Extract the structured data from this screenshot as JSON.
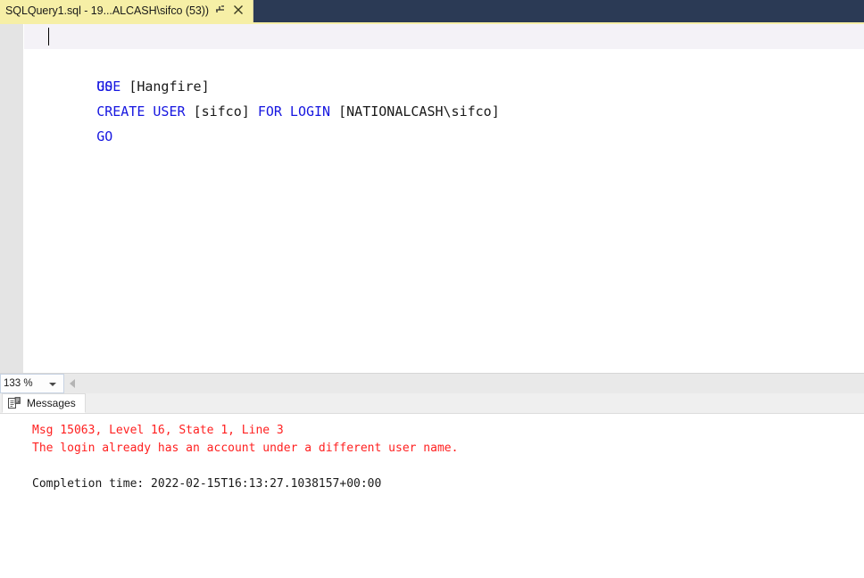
{
  "window": {
    "tabstrip_bg": "#2b3a55",
    "active_tab_bg": "#f6efa6"
  },
  "document_tab": {
    "title": "SQLQuery1.sql - 19...ALCASH\\sifco (53))",
    "pin_icon": "pin-icon",
    "close_icon": "close-icon"
  },
  "editor": {
    "keyword_color": "#1717e0",
    "text_color": "#1a1a1a",
    "lines": [
      {
        "segments": [
          {
            "text": "USE ",
            "type": "keyword"
          },
          {
            "text": "[Hangfire]",
            "type": "plain"
          }
        ]
      },
      {
        "segments": [
          {
            "text": "GO",
            "type": "keyword"
          }
        ]
      },
      {
        "segments": [
          {
            "text": "CREATE USER ",
            "type": "keyword"
          },
          {
            "text": "[sifco] ",
            "type": "plain"
          },
          {
            "text": "FOR LOGIN ",
            "type": "keyword"
          },
          {
            "text": "[NATIONALCASH\\sifco]",
            "type": "plain"
          }
        ]
      },
      {
        "segments": [
          {
            "text": "GO",
            "type": "keyword"
          }
        ]
      }
    ],
    "line1_text": "USE ",
    "line1_rest": "[Hangfire]",
    "line2_text": "GO",
    "line3_kw1": "CREATE USER ",
    "line3_arg1": "[sifco] ",
    "line3_kw2": "FOR LOGIN ",
    "line3_arg2": "[NATIONALCASH\\sifco]",
    "line4_text": "GO"
  },
  "status_row": {
    "zoom_level": "133 %",
    "zoom_dropdown_icon": "chevron-down-icon",
    "scroll_left_icon": "scroll-left-arrow-icon"
  },
  "results": {
    "tab_label": "Messages",
    "tab_icon": "messages-icon",
    "error_color": "#ff2020",
    "messages": [
      {
        "text": "Msg 15063, Level 16, State 1, Line 3",
        "style": "error"
      },
      {
        "text": "The login already has an account under a different user name.",
        "style": "error"
      },
      {
        "text": "",
        "style": "blank"
      },
      {
        "text": "Completion time: 2022-02-15T16:13:27.1038157+00:00",
        "style": "normal"
      }
    ],
    "msg_error_line1": "Msg 15063, Level 16, State 1, Line 3",
    "msg_error_line2": "The login already has an account under a different user name.",
    "msg_completion": "Completion time: 2022-02-15T16:13:27.1038157+00:00"
  }
}
